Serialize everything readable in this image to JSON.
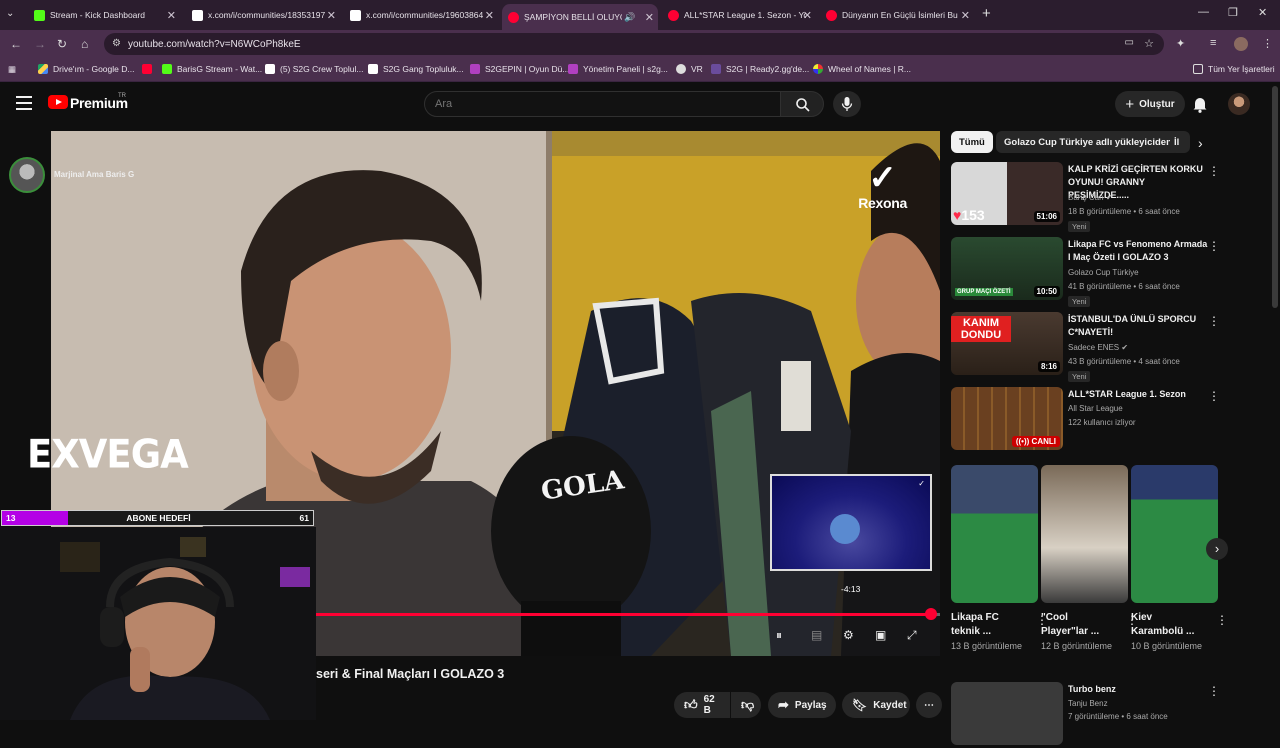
{
  "browser": {
    "tabs": [
      {
        "title": "Stream - Kick Dashboard",
        "color": "#53fc18"
      },
      {
        "title": "x.com/i/communities/18353197",
        "color": "#ffffff"
      },
      {
        "title": "x.com/i/communities/19603864",
        "color": "#ffffff"
      },
      {
        "title": "ŞAMPİYON BELLİ OLUYO",
        "color": "#ff0033"
      },
      {
        "title": "ALL*STAR League 1. Sezon - Yo",
        "color": "#ff0033"
      },
      {
        "title": "Dünyanın En Güçlü İsimleri Bu",
        "color": "#ff0033"
      }
    ],
    "url": "youtube.com/watch?v=N6WCoPh8keE",
    "bookmarks": [
      "Drive'ım - Google D...",
      "BarisG Stream - Wat...",
      "(5) S2G Crew Toplul...",
      "S2G Gang Topluluk...",
      "S2GEPIN | Oyun Dü...",
      "Yönetim Paneli | s2g...",
      "VR",
      "S2G | Ready2.gg'de...",
      "Wheel of Names | R...",
      "Tüm Yer İşaretleri"
    ]
  },
  "header": {
    "brand": "Premium",
    "country": "TR",
    "search_placeholder": "Ara",
    "create_label": "Oluştur"
  },
  "player": {
    "sponsor": "Rexona",
    "mic_text": "GOLA",
    "mini_time": "-4:13",
    "progress": 0.985
  },
  "overlay": {
    "streamer_name": "Marjinal Ama Baris G",
    "logo_text": "EXVEGA",
    "sub_goal": {
      "label": "ABONE HEDEFİ",
      "current": "13",
      "max": "61",
      "fraction": 0.213
    }
  },
  "video": {
    "title": "seri & Final Maçları I GOLAZO 3",
    "likes": "62 B",
    "share": "Paylaş",
    "save": "Kaydet"
  },
  "sidebar": {
    "chips": [
      "Tümü",
      "Golazo Cup Türkiye adlı yükleyiciden",
      "İl"
    ],
    "recommendations": [
      {
        "title": "KALP KRİZİ GEÇİRTEN KORKU OYUNU! GRANNY PEŞİMİZDE.....",
        "channel": "Barış Can",
        "meta": "18 B görüntüleme • 6 saat önce",
        "badge": "Yeni",
        "duration": "51:06",
        "overlay": "153"
      },
      {
        "title": "Likapa FC vs Fenomeno Armada I Maç Özeti I GOLAZO 3",
        "channel": "Golazo Cup Türkiye",
        "meta": "41 B görüntüleme • 6 saat önce",
        "badge": "Yeni",
        "duration": "10:50",
        "overlay": "GRUP MAÇI ÖZETİ"
      },
      {
        "title": "İSTANBUL'DA ÜNLÜ SPORCU C*NAYETİ!",
        "channel": "Sadece ENES",
        "meta": "43 B görüntüleme • 4 saat önce",
        "badge": "Yeni",
        "duration": "8:16",
        "overlay": "KANIM DONDU"
      },
      {
        "title": "ALL*STAR League 1. Sezon",
        "channel": "All Star League",
        "meta": "122 kullanıcı izliyor",
        "badge": "",
        "duration": "CANLI",
        "overlay": ""
      }
    ],
    "shorts": [
      {
        "title": "Likapa FC teknik ...",
        "views": "13 B görüntüleme"
      },
      {
        "title": "\"Cool Player\"lar ...",
        "views": "12 B görüntüleme"
      },
      {
        "title": "Kiev Karambolü ...",
        "views": "10 B görüntüleme"
      }
    ],
    "next": {
      "title": "Turbo benz",
      "channel": "Tanju Benz",
      "meta": "7 görüntüleme • 6 saat önce"
    }
  }
}
